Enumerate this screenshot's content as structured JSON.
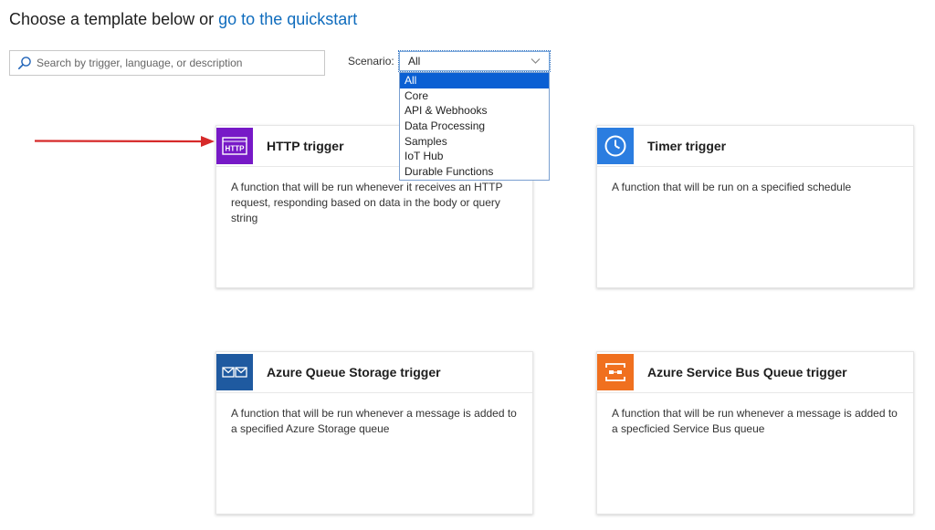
{
  "heading": {
    "prefix": "Choose a template below or",
    "link": "go to the quickstart"
  },
  "search": {
    "placeholder": "Search by trigger, language, or description",
    "icon": "search-icon"
  },
  "scenario": {
    "label": "Scenario:",
    "selected": "All",
    "options": [
      "All",
      "Core",
      "API & Webhooks",
      "Data Processing",
      "Samples",
      "IoT Hub",
      "Durable Functions"
    ]
  },
  "cards": [
    {
      "title": "HTTP trigger",
      "description": "A function that will be run whenever it receives an HTTP request, responding based on data in the body or query string",
      "icon": "http-icon",
      "icon_label": "HTTP",
      "color": "#7719c7"
    },
    {
      "title": "Timer trigger",
      "description": "A function that will be run on a specified schedule",
      "icon": "clock-icon",
      "color": "#2b7de0"
    },
    {
      "title": "Azure Queue Storage trigger",
      "description": "A function that will be run whenever a message is added to a specified Azure Storage queue",
      "icon": "queue-storage-icon",
      "color": "#1f5aa0"
    },
    {
      "title": "Azure Service Bus Queue trigger",
      "description": "A function that will be run whenever a message is added to a specficied Service Bus queue",
      "icon": "service-bus-icon",
      "color": "#f0701f"
    }
  ],
  "colors": {
    "link": "#0f6cbd",
    "dropdown_selected": "#0a5fd3",
    "annotation_arrow": "#d62a2a"
  }
}
